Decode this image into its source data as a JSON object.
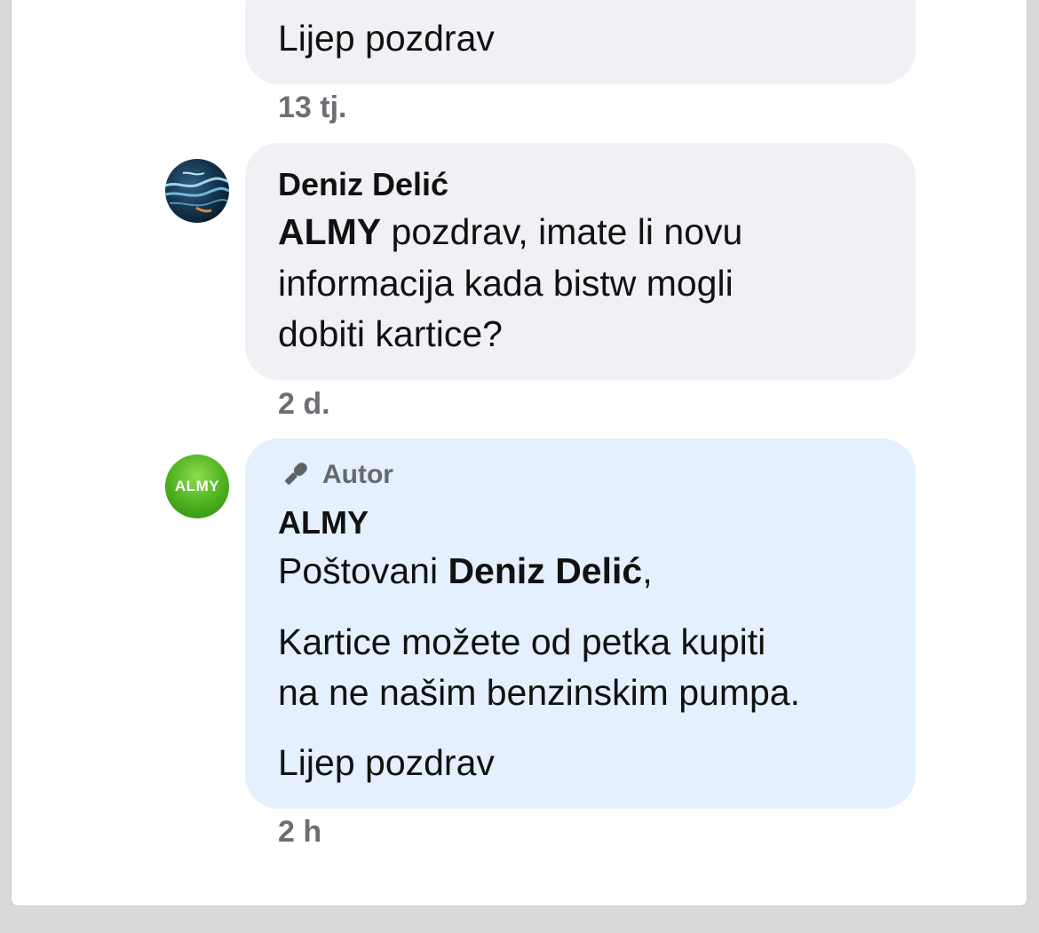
{
  "comments": [
    {
      "text": "Lijep pozdrav",
      "time": "13 tj."
    },
    {
      "author": "Deniz Delić",
      "mention": "ALMY",
      "text_rest": " pozdrav, imate li novu",
      "line2": "informacija kada bistw mogli",
      "line3": "dobiti kartice?",
      "time": "2 d.",
      "avatar_icon": "ocean-photo-avatar"
    },
    {
      "badge_icon": "microphone-icon",
      "badge_label": "Autor",
      "author": "ALMY",
      "greeting_prefix": "Poštovani ",
      "greeting_name": "Deniz Delić",
      "greeting_suffix": ",",
      "paragraph_line1": "Kartice možete od petka kupiti",
      "paragraph_line2": "na ne našim benzinskim pumpa.",
      "closing": "Lijep pozdrav",
      "time": "2 h",
      "avatar_text": "ALMY",
      "avatar_color": "#4caf1f"
    }
  ]
}
